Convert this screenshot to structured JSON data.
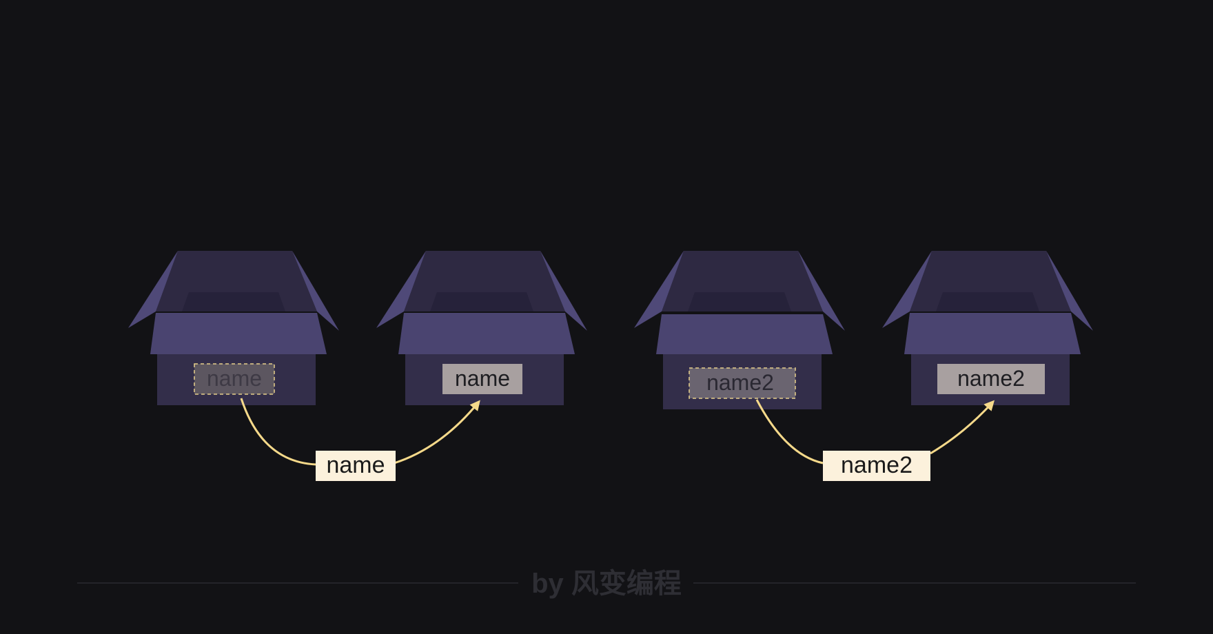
{
  "colors": {
    "background": "#121215",
    "box_front": "#332e4a",
    "box_band": "#4a4470",
    "box_flap": "#4f4978",
    "box_inner": "#2e2942",
    "box_inner_dark": "#26223a",
    "arrow": "#f5d98a",
    "arrow_label_bg": "#fcf1dc",
    "arrow_label_text": "#1a1a1a",
    "tag_bg": "#a8a0a0",
    "tag_text": "#1e1e22",
    "tag_ghost_bg": "#5c5660",
    "tag_ghost_text": "#3e3a45",
    "tag_ghost2_bg": "#6a6470",
    "tag_ghost2_text": "#2a2832",
    "tag_ghost_border": "#e6cf8a",
    "footer_text": "#2e2e34",
    "footer_line": "#2a2a30"
  },
  "boxes": [
    {
      "label": "name",
      "tag_style": "ghost"
    },
    {
      "label": "name",
      "tag_style": "solid"
    },
    {
      "label": "name2",
      "tag_style": "ghost-strong"
    },
    {
      "label": "name2",
      "tag_style": "solid"
    }
  ],
  "arrows": [
    {
      "label": "name"
    },
    {
      "label": "name2"
    }
  ],
  "footer": {
    "text": "by 风变编程"
  }
}
